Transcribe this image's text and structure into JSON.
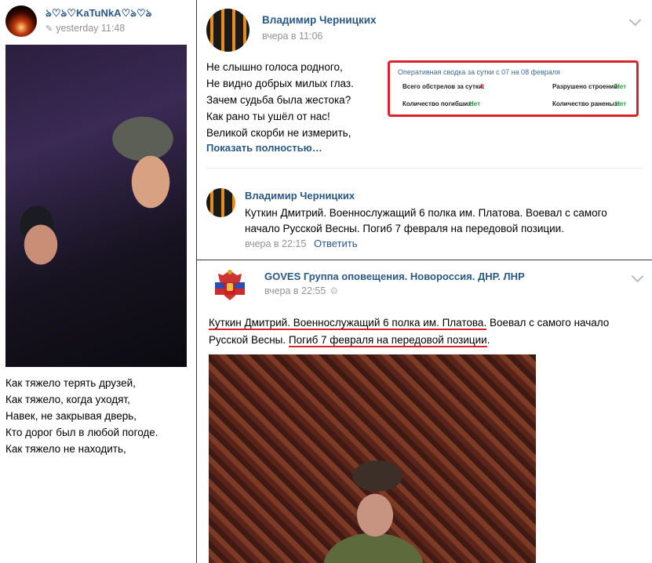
{
  "left_post": {
    "author": "ঌ♡ঌ♡KaTuNkA♡ঌ♡ঌ",
    "time": "yesterday 11:48",
    "verse": [
      "Как тяжело терять друзей,",
      "Как тяжело, когда уходят,",
      "Навек, не закрывая дверь,",
      "Кто дорог был в любой погоде.",
      "Как тяжело не находить,"
    ]
  },
  "post1": {
    "author": "Владимир Черницких",
    "time": "вчера в 11:06",
    "verse": [
      "Не слышно голоса родного,",
      "Не видно добрых милых глаз.",
      "Зачем судьба была жестока?",
      "Как рано ты ушёл от нас!",
      "Великой скорби не измерить,"
    ],
    "show_more": "Показать полностью…",
    "summary": {
      "title": "Оперативная сводка за сутки с 07 на 08 февраля",
      "shelling_label": "Всего обстрелов за сутки:",
      "shelling_value": "6",
      "destroyed_label": "Разрушено строений:",
      "destroyed_value": "Нет",
      "killed_label": "Количество погибших:",
      "killed_value": "Нет",
      "wounded_label": "Количество раненых:",
      "wounded_value": "Нет"
    }
  },
  "comment": {
    "author": "Владимир Черницких",
    "text_line1": "Куткин Дмитрий. Военнослужащий 6 полка им. Платова. Воевал с самого",
    "text_line2": "начало Русской Весны. Погиб 7 февраля на передовой позиции.",
    "time": "вчера в 22:15",
    "reply": "Ответить"
  },
  "post2": {
    "author": "GOVES Группа оповещения. Новороссия. ДНР. ЛНР",
    "time": "вчера в 22:55",
    "underlined1": "Куткин Дмитрий. Военнослужащий 6 полка им. Платова.",
    "plain1": " Воевал с самого начало",
    "plain2": "Русской Весны. ",
    "underlined2": "Погиб 7 февраля на передовой позиции",
    "plain3": "."
  },
  "colors": {
    "link": "#2a5885",
    "meta": "#939393",
    "highlight": "#d8232a",
    "green": "#2b9a3d"
  }
}
